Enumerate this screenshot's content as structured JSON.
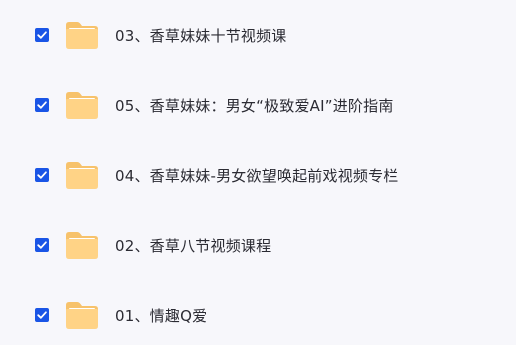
{
  "colors": {
    "background": "#f7f7fb",
    "checkbox": "#1a55e6",
    "folder_back": "#f7c26b",
    "folder_front": "#ffd386",
    "text": "#2b2b33"
  },
  "icons": {
    "checkbox": "checked-checkbox-icon",
    "folder": "folder-icon"
  },
  "files": [
    {
      "name": "03、香草妹妹十节视频课",
      "checked": true
    },
    {
      "name": "05、香草妹妹：男女“极致爱AI”进阶指南",
      "checked": true
    },
    {
      "name": "04、香草妹妹-男女欲望唤起前戏视频专栏",
      "checked": true
    },
    {
      "name": "02、香草八节视频课程",
      "checked": true
    },
    {
      "name": "01、情趣Q爱",
      "checked": true
    }
  ]
}
